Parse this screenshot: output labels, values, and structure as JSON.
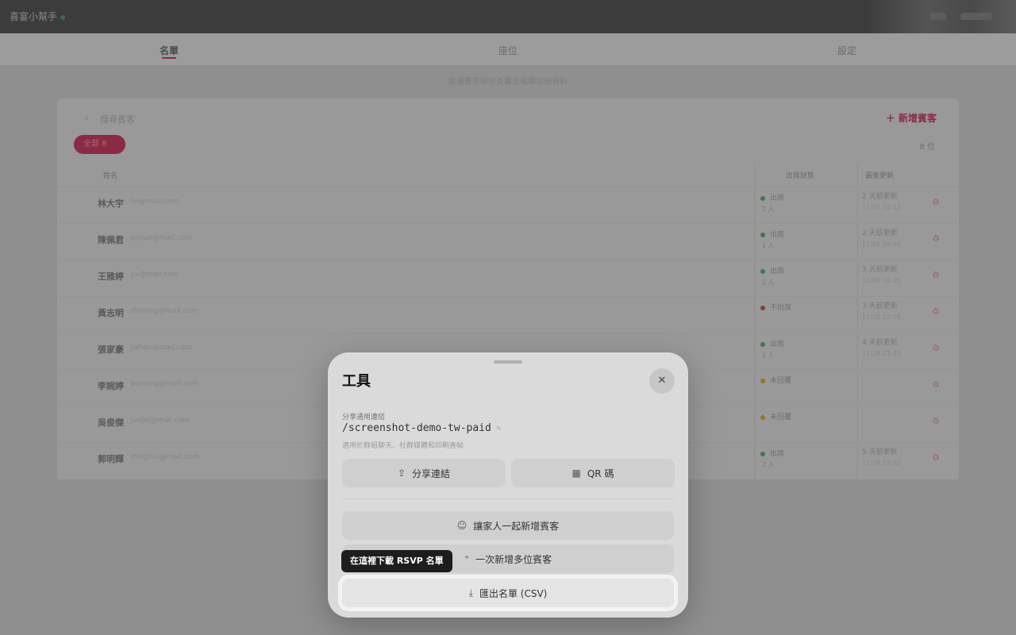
{
  "app": {
    "brand": "喜宴小幫手"
  },
  "tabs": [
    {
      "label": "名單"
    },
    {
      "label": "座位"
    },
    {
      "label": "設定"
    }
  ],
  "hint": "點選賓客即可查看並編輯詳細資料",
  "list": {
    "search_placeholder": "搜尋賓客",
    "add_button": "新增賓客",
    "filter_chip": "全部 8",
    "count": "8 位",
    "headers": {
      "name": "姓名",
      "status": "出席狀態",
      "updated": "最後更新"
    },
    "rows": [
      {
        "name": "林大宇",
        "email": "lin@mail.com",
        "status": "出席",
        "sub": "2 人",
        "time": "2 天前更新",
        "time_sub": "12/01 10:12",
        "color": "#3a7a4c"
      },
      {
        "name": "陳佩君",
        "email": "peijun@mail.com",
        "status": "出席",
        "sub": "1 人",
        "time": "2 天前更新",
        "time_sub": "12/01 09:40",
        "color": "#3a7a4c"
      },
      {
        "name": "王雅婷",
        "email": "ya@mail.com",
        "status": "出席",
        "sub": "2 人",
        "time": "3 天前更新",
        "time_sub": "11/30 18:20",
        "color": "#3a7a4c"
      },
      {
        "name": "黃志明",
        "email": "zhiming@mail.com",
        "status": "不出席",
        "sub": "",
        "time": "3 天前更新",
        "time_sub": "11/30 12:05",
        "color": "#8a3a3a"
      },
      {
        "name": "張家豪",
        "email": "jiahao@mail.com",
        "status": "出席",
        "sub": "1 人",
        "time": "4 天前更新",
        "time_sub": "11/29 21:33",
        "color": "#3a7a4c"
      },
      {
        "name": "李婉婷",
        "email": "wanting@mail.com",
        "status": "未回覆",
        "sub": "",
        "time": "",
        "time_sub": "",
        "color": "#8a7a2a"
      },
      {
        "name": "吳俊傑",
        "email": "junjie@mail.com",
        "status": "未回覆",
        "sub": "",
        "time": "",
        "time_sub": "",
        "color": "#8a7a2a"
      },
      {
        "name": "郭明輝",
        "email": "minghui@mail.com",
        "status": "出席",
        "sub": "2 人",
        "time": "5 天前更新",
        "time_sub": "11/28 15:02",
        "color": "#3a7a4c"
      }
    ]
  },
  "sheet": {
    "title": "工具",
    "share_label": "分享通用連結",
    "share_link": "/screenshot-demo-tw-paid",
    "share_desc": "適用於群組聊天、社群媒體和印刷喜帖",
    "share_button": "分享連結",
    "qr_button": "QR 碼",
    "family_button": "讓家人一起新增賓客",
    "bulk_button": "一次新增多位賓客",
    "export_button": "匯出名單 (CSV)",
    "tooltip": "在這裡下載 RSVP 名單"
  }
}
